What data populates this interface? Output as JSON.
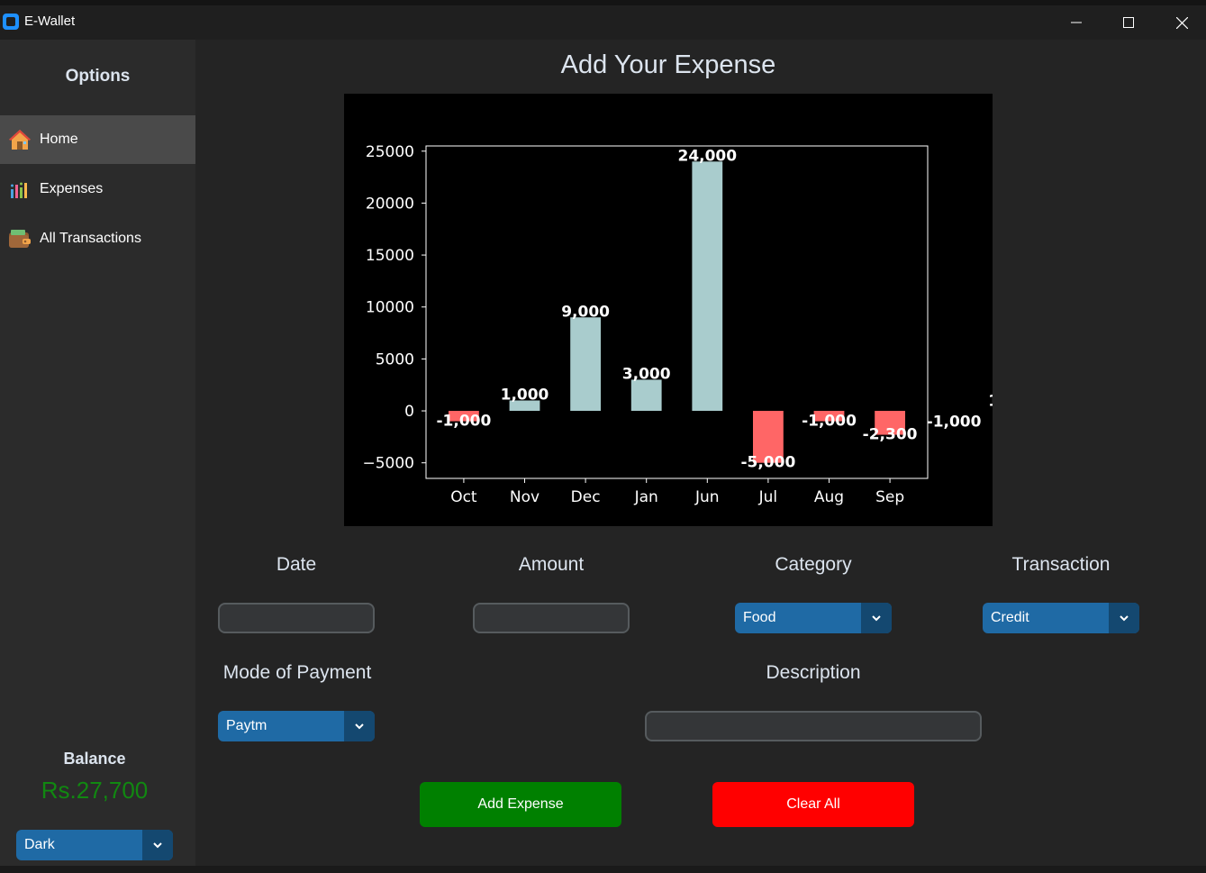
{
  "window": {
    "title": "E-Wallet"
  },
  "sidebar": {
    "title": "Options",
    "items": [
      {
        "label": "Home",
        "icon": "house-icon",
        "active": true
      },
      {
        "label": "Expenses",
        "icon": "bar-chart-icon",
        "active": false
      },
      {
        "label": "All Transactions",
        "icon": "wallet-icon",
        "active": false
      }
    ],
    "balance_label": "Balance",
    "balance_value": "Rs.27,700",
    "theme_value": "Dark"
  },
  "main": {
    "title": "Add Your Expense",
    "labels": {
      "date": "Date",
      "amount": "Amount",
      "category": "Category",
      "transaction": "Transaction",
      "mode": "Mode of Payment",
      "description": "Description"
    },
    "fields": {
      "date_value": "",
      "amount_value": "",
      "description_value": "",
      "category_value": "Food",
      "transaction_value": "Credit",
      "mode_value": "Paytm"
    },
    "add_button": "Add Expense",
    "clear_button": "Clear All"
  },
  "colors": {
    "positive_bar": "#a9cccd",
    "negative_bar": "#ff6666",
    "add_button": "#008000",
    "clear_button": "#ff0000",
    "balance": "#118811",
    "accent": "#1f6aa5"
  },
  "chart_data": {
    "type": "bar",
    "categories": [
      "Oct",
      "Nov",
      "Dec",
      "Jan",
      "Jun",
      "Jul",
      "Aug",
      "Sep"
    ],
    "values": [
      -1000,
      1000,
      9000,
      3000,
      24000,
      -5000,
      -1000,
      -2300
    ],
    "data_labels": [
      "-1,000",
      "1,000",
      "9,000",
      "3,000",
      "24,000",
      "-5,000",
      "-1,000",
      "-2,300"
    ],
    "extra_labels": [
      {
        "text": "-1,000",
        "x": 8.05,
        "y": -1000
      },
      {
        "text": "1",
        "x": 8.7,
        "y": 1000
      }
    ],
    "yticks": [
      -5000,
      0,
      5000,
      10000,
      15000,
      20000,
      25000
    ],
    "ylim": [
      -6500,
      25500
    ],
    "xlim": [
      -0.62,
      7.62
    ],
    "title": "",
    "xlabel": "",
    "ylabel": "",
    "grid": false,
    "background": "#000000"
  }
}
